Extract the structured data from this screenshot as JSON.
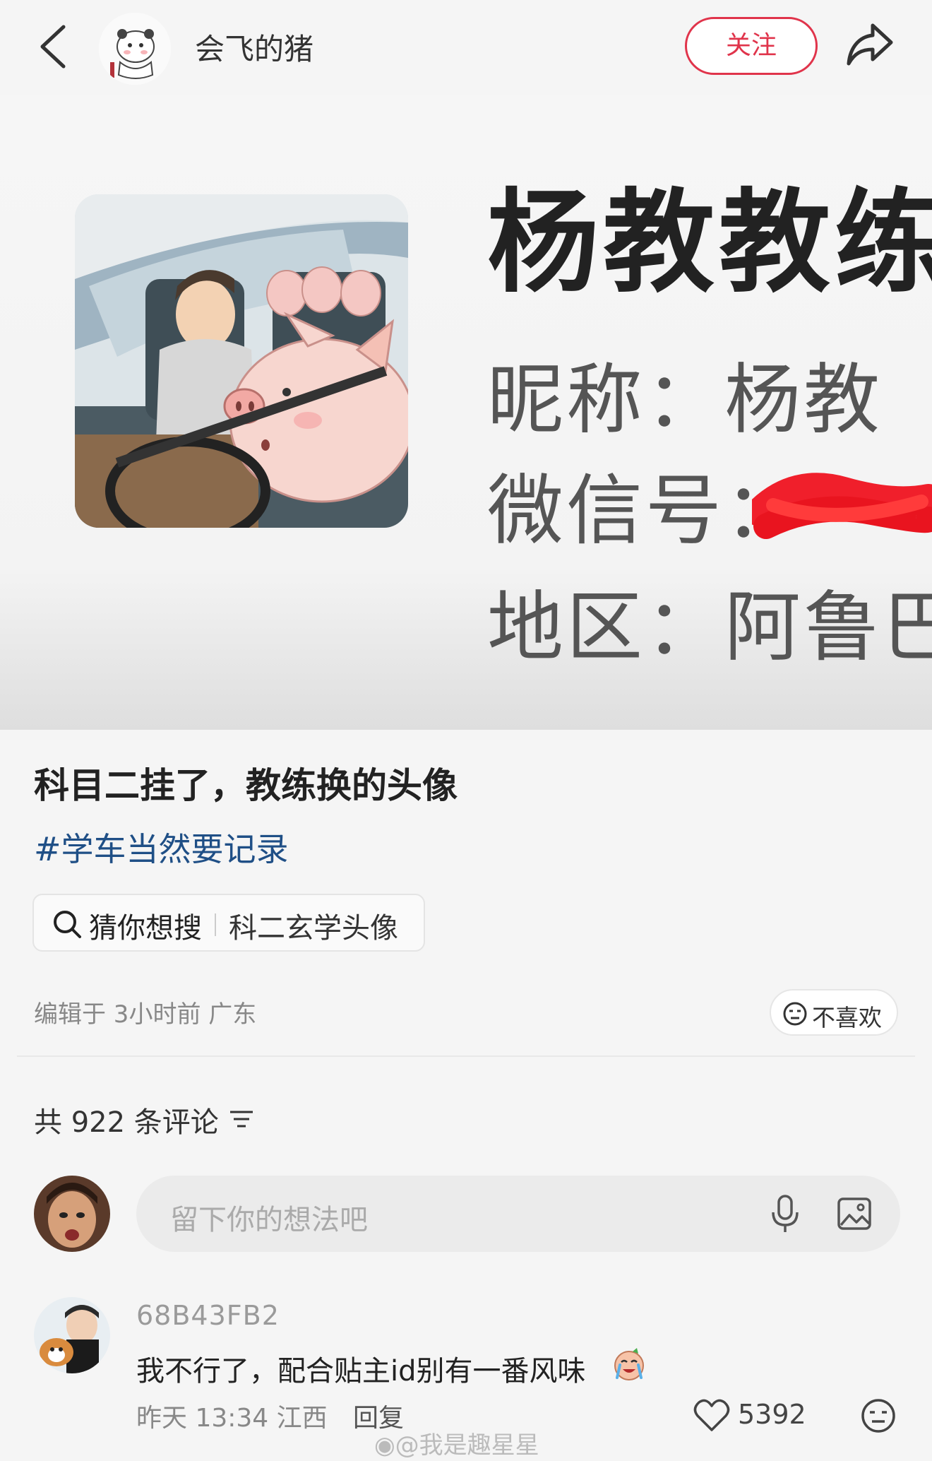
{
  "header": {
    "username": "会飞的猪",
    "follow_label": "关注"
  },
  "post_image": {
    "big_title": "杨教教练",
    "nickname_line": "昵称：杨教",
    "wechat_line": "微信号：",
    "region_line": "地区：阿鲁巴"
  },
  "post": {
    "title": "科目二挂了，教练换的头像",
    "hashtag": "#学车当然要记录",
    "search_prefix": "猜你想搜",
    "search_suggestion": "科二玄学头像",
    "edit_meta": "编辑于 3小时前 广东",
    "dislike_label": "不喜欢"
  },
  "comments": {
    "count_label": "共 922 条评论",
    "input_placeholder": "留下你的想法吧",
    "items": [
      {
        "user": "68B43FB2",
        "text": "我不行了，配合贴主id别有一番风味",
        "time": "昨天 13:34 江西",
        "reply_label": "回复",
        "likes": "5392"
      }
    ]
  },
  "watermark": "@我是趣星星",
  "colors": {
    "accent": "#e0344b",
    "hashtag": "#1f4f86",
    "background": "#f5f5f5"
  },
  "icons": [
    "back-icon",
    "share-icon",
    "search-icon",
    "dislike-face-icon",
    "sort-icon",
    "mic-icon",
    "image-icon",
    "heart-icon",
    "comment-face-icon",
    "weibo-icon"
  ]
}
